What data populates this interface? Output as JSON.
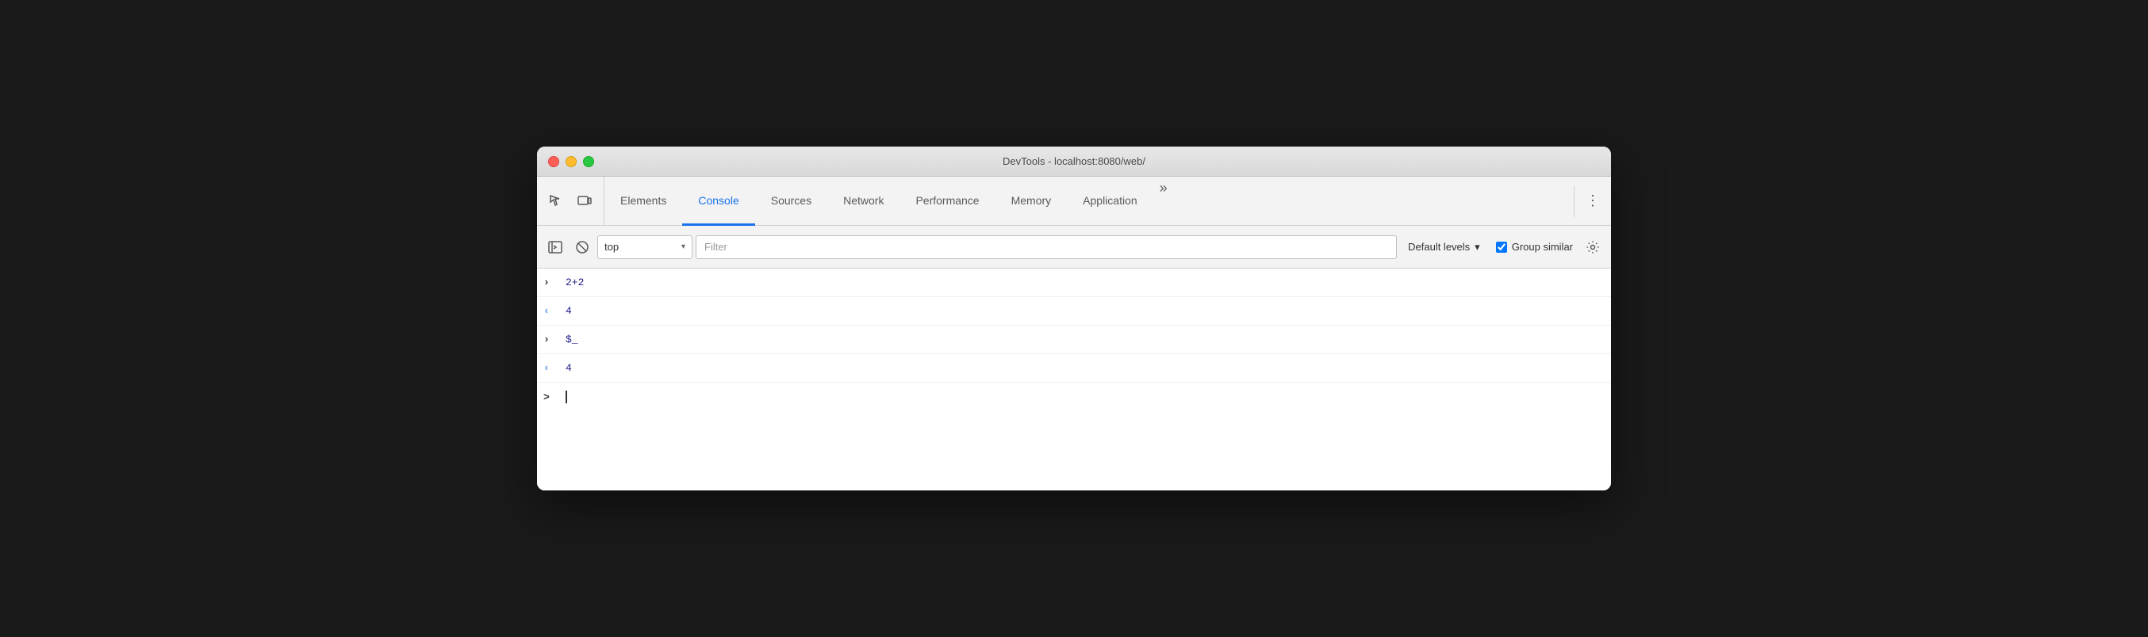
{
  "window": {
    "title": "DevTools - localhost:8080/web/",
    "traffic_lights": {
      "close": "close",
      "minimize": "minimize",
      "maximize": "maximize"
    }
  },
  "tab_bar": {
    "inspect_icon": "inspect-element-icon",
    "device_icon": "device-toolbar-icon",
    "tabs": [
      {
        "id": "elements",
        "label": "Elements",
        "active": false
      },
      {
        "id": "console",
        "label": "Console",
        "active": true
      },
      {
        "id": "sources",
        "label": "Sources",
        "active": false
      },
      {
        "id": "network",
        "label": "Network",
        "active": false
      },
      {
        "id": "performance",
        "label": "Performance",
        "active": false
      },
      {
        "id": "memory",
        "label": "Memory",
        "active": false
      },
      {
        "id": "application",
        "label": "Application",
        "active": false
      }
    ],
    "more_label": "»",
    "kebab_label": "⋮"
  },
  "toolbar": {
    "sidebar_icon": "show-console-sidebar-icon",
    "clear_icon": "clear-console-icon",
    "context_value": "top",
    "context_placeholder": "top",
    "filter_placeholder": "Filter",
    "levels_label": "Default levels",
    "group_similar_label": "Group similar",
    "group_similar_checked": true,
    "settings_icon": "settings-icon"
  },
  "console": {
    "lines": [
      {
        "arrow": ">",
        "arrow_type": "right",
        "value": "2+2",
        "value_type": "input"
      },
      {
        "arrow": "<",
        "arrow_type": "left",
        "value": "4",
        "value_type": "output"
      },
      {
        "arrow": ">",
        "arrow_type": "right",
        "value": "$_",
        "value_type": "input"
      },
      {
        "arrow": "<",
        "arrow_type": "left",
        "value": "4",
        "value_type": "output"
      }
    ],
    "prompt_arrow": ">",
    "prompt_arrow_type": "right"
  }
}
